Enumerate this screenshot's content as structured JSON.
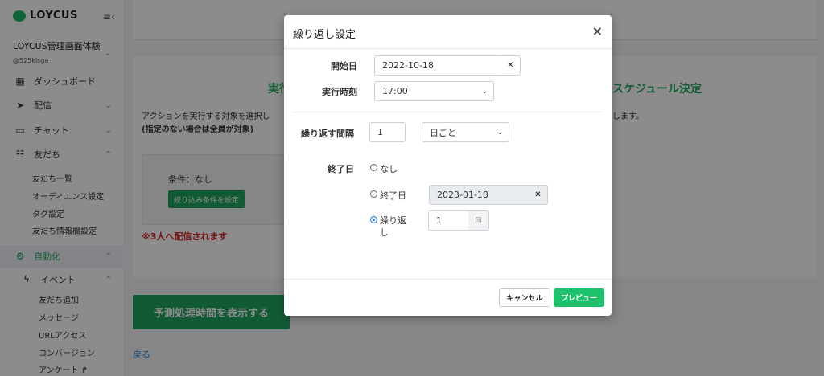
{
  "brand": {
    "name": "LOYCUS",
    "color": "#1fa760"
  },
  "account": {
    "name": "LOYCUS管理画面体験",
    "id": "@525kisga"
  },
  "sidebar": {
    "items": [
      {
        "label": "ダッシュボード",
        "icon": "grid-icon"
      },
      {
        "label": "配信",
        "icon": "send-icon"
      },
      {
        "label": "チャット",
        "icon": "chat-icon"
      },
      {
        "label": "友だち",
        "icon": "users-icon"
      }
    ],
    "friends_sub": [
      "友だち一覧",
      "オーディエンス設定",
      "タグ設定",
      "友だち情報欄設定"
    ],
    "automation": {
      "label": "自動化",
      "icon": "robot-icon"
    },
    "event": {
      "label": "イベント",
      "icon": "bolt-icon"
    },
    "event_sub": [
      "友だち追加",
      "メッセージ",
      "URLアクセス",
      "コンバージョン",
      "アンケート ↱"
    ]
  },
  "main": {
    "heading_left": "実行",
    "heading_right": "スケジュール決定",
    "description": "アクションを実行する対象を選択し",
    "description_end": "します。",
    "description_bold": "(指定のない場合は全員が対象)",
    "condition_label": "条件：なし",
    "condition_button": "絞り込み条件を設定",
    "warning": "※3人へ配信されます",
    "predict_button": "予測処理時間を表示する",
    "back_link": "戻る"
  },
  "modal": {
    "title": "繰り返し設定",
    "start_date_label": "開始日",
    "start_date_value": "2022-10-18",
    "exec_time_label": "実行時刻",
    "exec_time_value": "17:00",
    "interval_label": "繰り返す間隔",
    "interval_value": "1",
    "interval_unit": "日ごと",
    "end_date_label": "終了日",
    "end_options": {
      "none": "なし",
      "end_date": "終了日",
      "repeat": "繰り返し"
    },
    "end_date_value": "2023-01-18",
    "repeat_count": "1",
    "repeat_unit": "回",
    "selected_end_option": "repeat",
    "cancel_label": "キャンセル",
    "preview_label": "プレビュー"
  }
}
